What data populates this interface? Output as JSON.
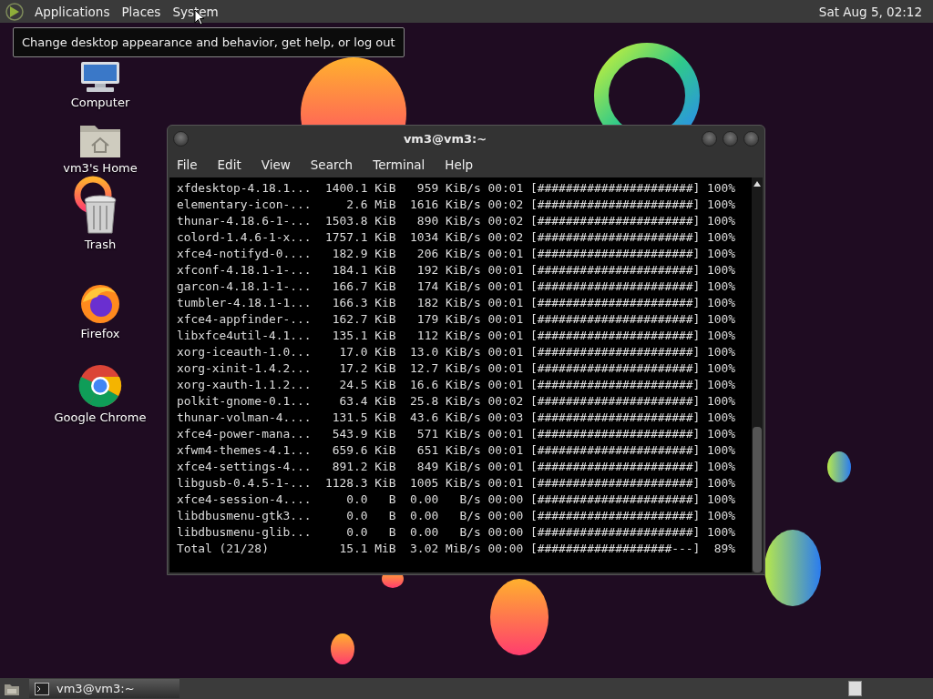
{
  "top_panel": {
    "menus": [
      "Applications",
      "Places",
      "System"
    ],
    "clock": "Sat Aug 5, 02:12"
  },
  "tooltip": "Change desktop appearance and behavior, get help, or log out",
  "desktop_icons": [
    {
      "kind": "computer",
      "label": "Computer"
    },
    {
      "kind": "home",
      "label": "vm3's Home"
    },
    {
      "kind": "trash",
      "label": "Trash"
    },
    {
      "kind": "firefox",
      "label": "Firefox"
    },
    {
      "kind": "chrome",
      "label": "Google Chrome"
    }
  ],
  "terminal": {
    "title": "vm3@vm3:~",
    "menu": [
      "File",
      "Edit",
      "View",
      "Search",
      "Terminal",
      "Help"
    ],
    "rows": [
      {
        "name": "xfdesktop-4.18.1...",
        "size": "1400.1",
        "size_unit": "KiB",
        "speed": "959",
        "speed_unit": "KiB/s",
        "time": "00:01",
        "bar": "[######################]",
        "percent": "100%"
      },
      {
        "name": "elementary-icon-...",
        "size": "2.6",
        "size_unit": "MiB",
        "speed": "1616",
        "speed_unit": "KiB/s",
        "time": "00:02",
        "bar": "[######################]",
        "percent": "100%"
      },
      {
        "name": "thunar-4.18.6-1-...",
        "size": "1503.8",
        "size_unit": "KiB",
        "speed": "890",
        "speed_unit": "KiB/s",
        "time": "00:02",
        "bar": "[######################]",
        "percent": "100%"
      },
      {
        "name": "colord-1.4.6-1-x...",
        "size": "1757.1",
        "size_unit": "KiB",
        "speed": "1034",
        "speed_unit": "KiB/s",
        "time": "00:02",
        "bar": "[######################]",
        "percent": "100%"
      },
      {
        "name": "xfce4-notifyd-0....",
        "size": "182.9",
        "size_unit": "KiB",
        "speed": "206",
        "speed_unit": "KiB/s",
        "time": "00:01",
        "bar": "[######################]",
        "percent": "100%"
      },
      {
        "name": "xfconf-4.18.1-1-...",
        "size": "184.1",
        "size_unit": "KiB",
        "speed": "192",
        "speed_unit": "KiB/s",
        "time": "00:01",
        "bar": "[######################]",
        "percent": "100%"
      },
      {
        "name": "garcon-4.18.1-1-...",
        "size": "166.7",
        "size_unit": "KiB",
        "speed": "174",
        "speed_unit": "KiB/s",
        "time": "00:01",
        "bar": "[######################]",
        "percent": "100%"
      },
      {
        "name": "tumbler-4.18.1-1...",
        "size": "166.3",
        "size_unit": "KiB",
        "speed": "182",
        "speed_unit": "KiB/s",
        "time": "00:01",
        "bar": "[######################]",
        "percent": "100%"
      },
      {
        "name": "xfce4-appfinder-...",
        "size": "162.7",
        "size_unit": "KiB",
        "speed": "179",
        "speed_unit": "KiB/s",
        "time": "00:01",
        "bar": "[######################]",
        "percent": "100%"
      },
      {
        "name": "libxfce4util-4.1...",
        "size": "135.1",
        "size_unit": "KiB",
        "speed": "112",
        "speed_unit": "KiB/s",
        "time": "00:01",
        "bar": "[######################]",
        "percent": "100%"
      },
      {
        "name": "xorg-iceauth-1.0...",
        "size": "17.0",
        "size_unit": "KiB",
        "speed": "13.0",
        "speed_unit": "KiB/s",
        "time": "00:01",
        "bar": "[######################]",
        "percent": "100%"
      },
      {
        "name": "xorg-xinit-1.4.2...",
        "size": "17.2",
        "size_unit": "KiB",
        "speed": "12.7",
        "speed_unit": "KiB/s",
        "time": "00:01",
        "bar": "[######################]",
        "percent": "100%"
      },
      {
        "name": "xorg-xauth-1.1.2...",
        "size": "24.5",
        "size_unit": "KiB",
        "speed": "16.6",
        "speed_unit": "KiB/s",
        "time": "00:01",
        "bar": "[######################]",
        "percent": "100%"
      },
      {
        "name": "polkit-gnome-0.1...",
        "size": "63.4",
        "size_unit": "KiB",
        "speed": "25.8",
        "speed_unit": "KiB/s",
        "time": "00:02",
        "bar": "[######################]",
        "percent": "100%"
      },
      {
        "name": "thunar-volman-4....",
        "size": "131.5",
        "size_unit": "KiB",
        "speed": "43.6",
        "speed_unit": "KiB/s",
        "time": "00:03",
        "bar": "[######################]",
        "percent": "100%"
      },
      {
        "name": "xfce4-power-mana...",
        "size": "543.9",
        "size_unit": "KiB",
        "speed": "571",
        "speed_unit": "KiB/s",
        "time": "00:01",
        "bar": "[######################]",
        "percent": "100%"
      },
      {
        "name": "xfwm4-themes-4.1...",
        "size": "659.6",
        "size_unit": "KiB",
        "speed": "651",
        "speed_unit": "KiB/s",
        "time": "00:01",
        "bar": "[######################]",
        "percent": "100%"
      },
      {
        "name": "xfce4-settings-4...",
        "size": "891.2",
        "size_unit": "KiB",
        "speed": "849",
        "speed_unit": "KiB/s",
        "time": "00:01",
        "bar": "[######################]",
        "percent": "100%"
      },
      {
        "name": "libgusb-0.4.5-1-...",
        "size": "1128.3",
        "size_unit": "KiB",
        "speed": "1005",
        "speed_unit": "KiB/s",
        "time": "00:01",
        "bar": "[######################]",
        "percent": "100%"
      },
      {
        "name": "xfce4-session-4....",
        "size": "0.0",
        "size_unit": "B",
        "speed": "0.00",
        "speed_unit": "B/s",
        "time": "00:00",
        "bar": "[######################]",
        "percent": "100%"
      },
      {
        "name": "libdbusmenu-gtk3...",
        "size": "0.0",
        "size_unit": "B",
        "speed": "0.00",
        "speed_unit": "B/s",
        "time": "00:00",
        "bar": "[######################]",
        "percent": "100%"
      },
      {
        "name": "libdbusmenu-glib...",
        "size": "0.0",
        "size_unit": "B",
        "speed": "0.00",
        "speed_unit": "B/s",
        "time": "00:00",
        "bar": "[######################]",
        "percent": "100%"
      },
      {
        "name": "Total (21/28)",
        "size": "15.1",
        "size_unit": "MiB",
        "speed": "3.02",
        "speed_unit": "MiB/s",
        "time": "00:00",
        "bar": "[###################---]",
        "percent": "89%"
      }
    ]
  },
  "taskbar": {
    "tasks": [
      {
        "label": "vm3@vm3:~",
        "selected": true
      }
    ]
  }
}
